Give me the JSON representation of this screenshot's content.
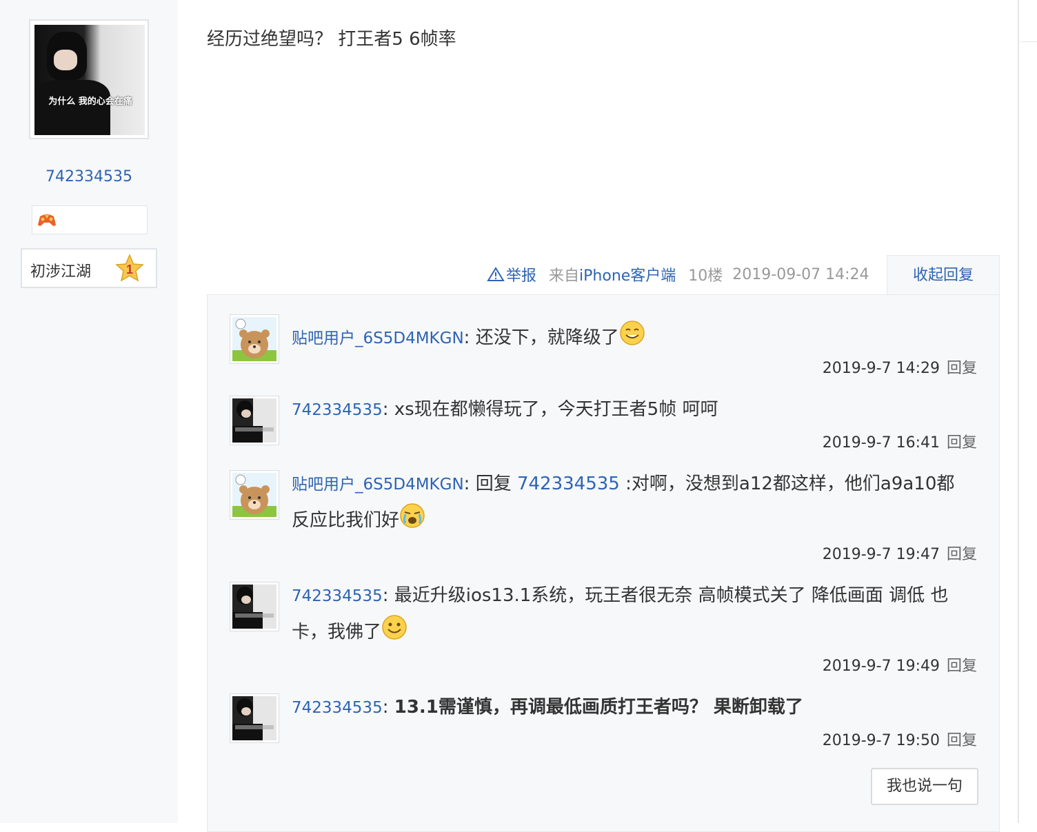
{
  "author": {
    "name": "742334535",
    "avatar_caption": "为什么 我的心会在痛",
    "level_label": "初涉江湖",
    "level_number": "1",
    "badge_icon": "game-controller-icon"
  },
  "post": {
    "content": "经历过绝望吗？ 打王者5 6帧率",
    "report_label": "举报",
    "client_prefix": "来自",
    "client_name": "iPhone客户端",
    "floor": "10楼",
    "datetime": "2019-09-07 14:24",
    "collapse_label": "收起回复"
  },
  "replies": [
    {
      "user": "贴吧用户_6S5D4MKGN",
      "avatar": "bear-avatar",
      "text": "还没下，就降级了",
      "emoji": "grin-emoji",
      "time": "2019-9-7 14:29",
      "reply_label": "回复"
    },
    {
      "user": "742334535",
      "avatar": "boy-avatar",
      "text": "xs现在都懒得玩了，今天打王者5帧 呵呵",
      "time": "2019-9-7 16:41",
      "reply_label": "回复"
    },
    {
      "user": "贴吧用户_6S5D4MKGN",
      "avatar": "bear-avatar",
      "reply_prefix": "回复 ",
      "mention": "742334535",
      "text": " :对啊，没想到a12都这样，他们a9a10都",
      "text2": "反应比我们好",
      "emoji": "cry-emoji",
      "time": "2019-9-7 19:47",
      "reply_label": "回复"
    },
    {
      "user": "742334535",
      "avatar": "boy-avatar",
      "text": "最近升级ios13.1系统，玩王者很无奈 高帧模式关了 降低画面 调低 也",
      "text2": "卡，我佛了",
      "emoji": "smile-emoji",
      "time": "2019-9-7 19:49",
      "reply_label": "回复"
    },
    {
      "user": "742334535",
      "avatar": "boy-avatar",
      "text": "13.1需谨慎，再调最低画质打王者吗？ 果断卸载了",
      "time": "2019-9-7 19:50",
      "reply_label": "回复"
    }
  ],
  "say_button": "我也说一句",
  "colors": {
    "link": "#2d64b3",
    "panel": "#f7f8fa",
    "border": "#e1e3e6"
  }
}
